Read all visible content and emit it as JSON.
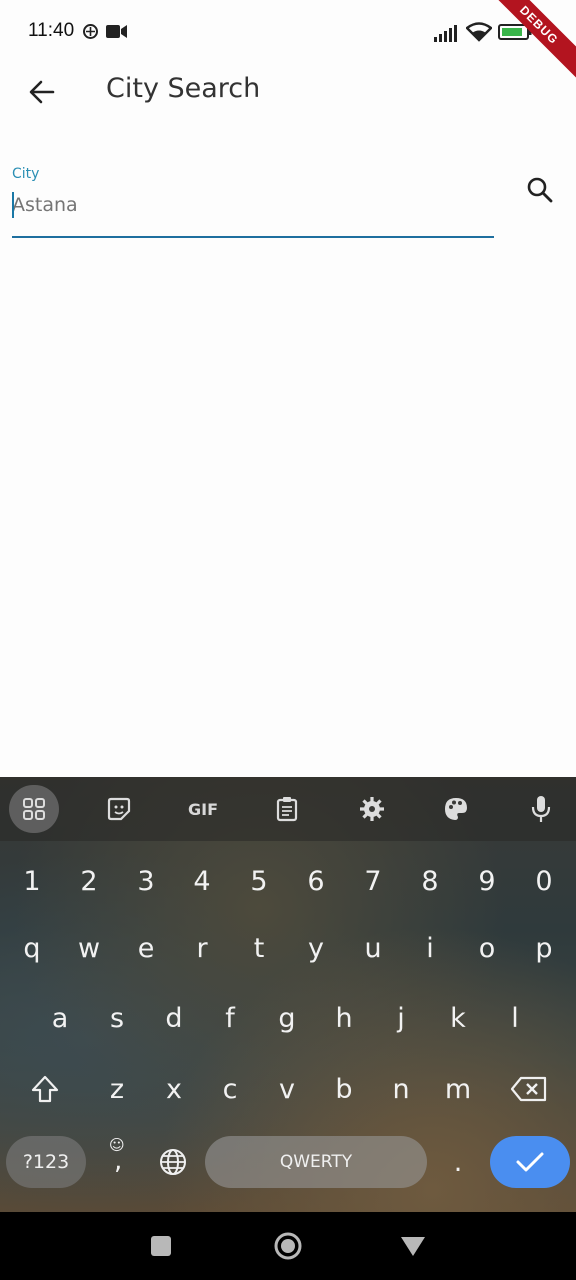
{
  "status_bar": {
    "time": "11:40",
    "debug_banner": "DEBUG"
  },
  "app_bar": {
    "title": "City Search",
    "back_icon": "arrow-left-icon"
  },
  "search": {
    "label": "City",
    "value": "",
    "placeholder": "Astana",
    "search_icon": "search-icon"
  },
  "keyboard": {
    "toolbar": [
      {
        "name": "apps",
        "icon": "grid-icon"
      },
      {
        "name": "sticker",
        "icon": "sticker-icon"
      },
      {
        "name": "gif",
        "label": "GIF"
      },
      {
        "name": "clipboard",
        "icon": "clipboard-icon"
      },
      {
        "name": "settings",
        "icon": "gear-icon"
      },
      {
        "name": "theme",
        "icon": "palette-icon"
      },
      {
        "name": "voice",
        "icon": "mic-icon"
      }
    ],
    "row_numbers": [
      "1",
      "2",
      "3",
      "4",
      "5",
      "6",
      "7",
      "8",
      "9",
      "0"
    ],
    "row1": [
      "q",
      "w",
      "e",
      "r",
      "t",
      "y",
      "u",
      "i",
      "o",
      "p"
    ],
    "row2": [
      "a",
      "s",
      "d",
      "f",
      "g",
      "h",
      "j",
      "k",
      "l"
    ],
    "row3": [
      "z",
      "x",
      "c",
      "v",
      "b",
      "n",
      "m"
    ],
    "symbols_key": "?123",
    "comma_key": ",",
    "space_label": "QWERTY",
    "period_key": ".",
    "accent_color": "#4a8ef0"
  }
}
